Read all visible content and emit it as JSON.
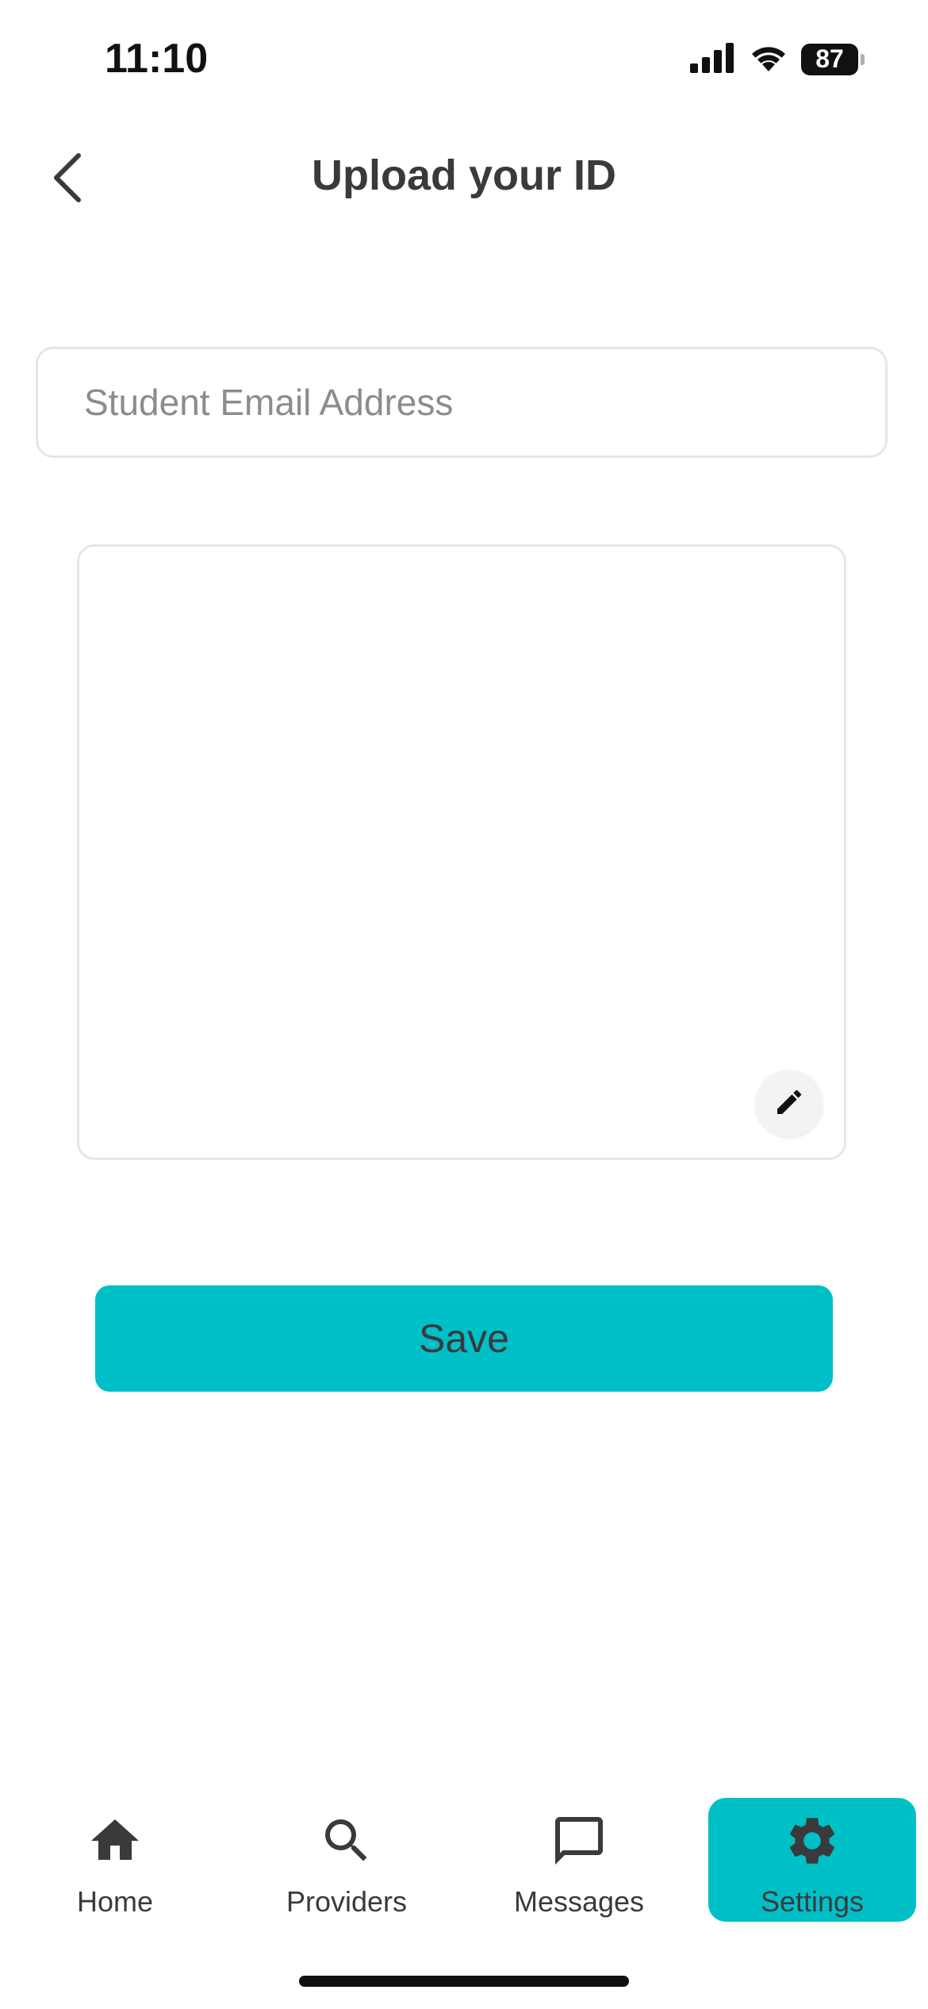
{
  "status_bar": {
    "time": "11:10",
    "battery": "87",
    "icons": [
      "cellular-signal-icon",
      "wifi-icon",
      "battery-icon"
    ]
  },
  "header": {
    "title": "Upload your ID",
    "back_icon": "chevron-left-icon"
  },
  "form": {
    "email_placeholder": "Student Email Address",
    "email_value": "",
    "edit_icon": "pencil-icon",
    "save_label": "Save"
  },
  "tabs": [
    {
      "label": "Home",
      "icon": "home-icon",
      "active": false
    },
    {
      "label": "Providers",
      "icon": "search-icon",
      "active": false
    },
    {
      "label": "Messages",
      "icon": "chat-bubble-icon",
      "active": false
    },
    {
      "label": "Settings",
      "icon": "gear-icon",
      "active": true
    }
  ],
  "colors": {
    "accent": "#00c0c7",
    "text": "#3a3a3c",
    "border": "#e6e6e6",
    "placeholder": "#8c8c8c"
  }
}
